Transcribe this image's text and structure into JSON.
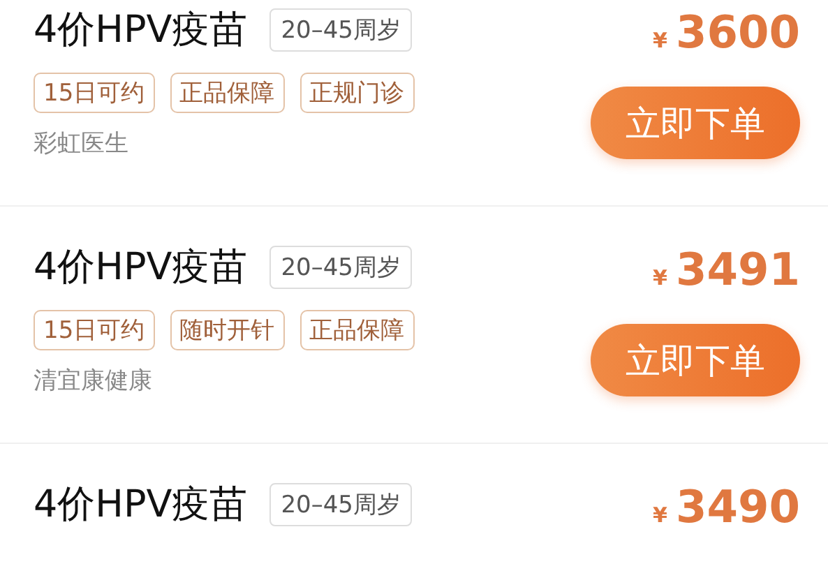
{
  "offers": [
    {
      "title": "4价HPV疫苗",
      "age": "20–45周岁",
      "tags": [
        "15日可约",
        "正品保障",
        "正规门诊"
      ],
      "clinic": "彩虹医生",
      "currency": "¥",
      "price": "3600",
      "button": "立即下单"
    },
    {
      "title": "4价HPV疫苗",
      "age": "20–45周岁",
      "tags": [
        "15日可约",
        "随时开针",
        "正品保障"
      ],
      "clinic": "清宜康健康",
      "currency": "¥",
      "price": "3491",
      "button": "立即下单"
    },
    {
      "title": "4价HPV疫苗",
      "age": "20–45周岁",
      "currency": "¥",
      "price": "3490"
    }
  ]
}
